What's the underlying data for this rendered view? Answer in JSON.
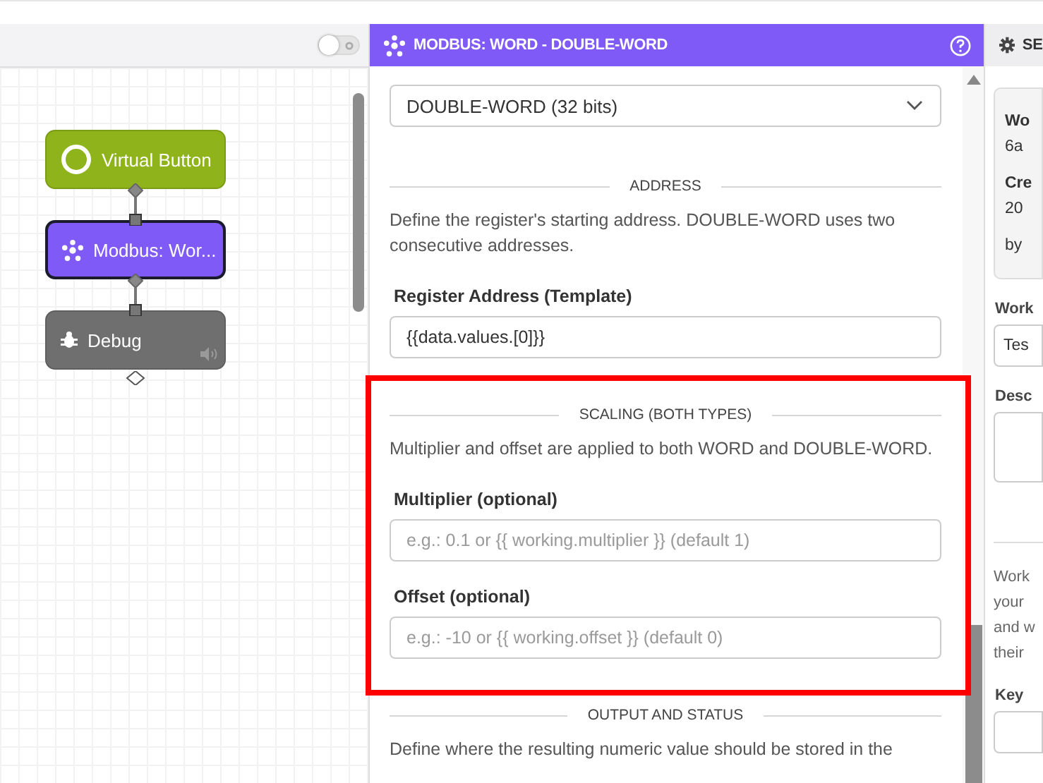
{
  "canvas": {
    "toggle": {
      "on": false
    },
    "nodes": [
      {
        "kind": "trigger",
        "label": "Virtual Button",
        "selected": false
      },
      {
        "kind": "modbus",
        "label": "Modbus: Wor...",
        "selected": true
      },
      {
        "kind": "debug",
        "label": "Debug",
        "selected": false
      }
    ]
  },
  "panel": {
    "title": "MODBUS: WORD - DOUBLE-WORD",
    "register_type": {
      "value": "DOUBLE-WORD (32 bits)"
    },
    "sections": [
      {
        "heading": "ADDRESS",
        "description": "Define the register's starting address. DOUBLE-WORD uses two consecutive addresses.",
        "highlighted": false,
        "fields": [
          {
            "label": "Register Address (Template)",
            "value": "{{data.values.[0]}}"
          }
        ]
      },
      {
        "heading": "SCALING (BOTH TYPES)",
        "description": "Multiplier and offset are applied to both WORD and DOUBLE-WORD.",
        "highlighted": true,
        "fields": [
          {
            "label": "Multiplier (optional)",
            "placeholder": "e.g.: 0.1 or {{ working.multiplier }} (default 1)"
          },
          {
            "label": "Offset (optional)",
            "placeholder": "e.g.: -10 or {{ working.offset }} (default 0)"
          }
        ]
      },
      {
        "heading": "OUTPUT AND STATUS",
        "description": "Define where the resulting numeric value should be stored in the",
        "highlighted": false
      }
    ]
  },
  "settings": {
    "tab": "SE",
    "info_card": [
      {
        "kind": "label",
        "text": "Wo"
      },
      {
        "kind": "value",
        "text": "6a"
      },
      {
        "kind": "label",
        "text": "Cre"
      },
      {
        "kind": "value",
        "text": "20"
      },
      {
        "kind": "value",
        "text": "by"
      }
    ],
    "fields": [
      {
        "kind": "input",
        "label": "Work",
        "value": "Tes"
      },
      {
        "kind": "textarea",
        "label": "Desc"
      }
    ],
    "help_lines": [
      "Work",
      "your",
      "and w",
      "their"
    ],
    "key_field": {
      "label": "Key"
    }
  }
}
